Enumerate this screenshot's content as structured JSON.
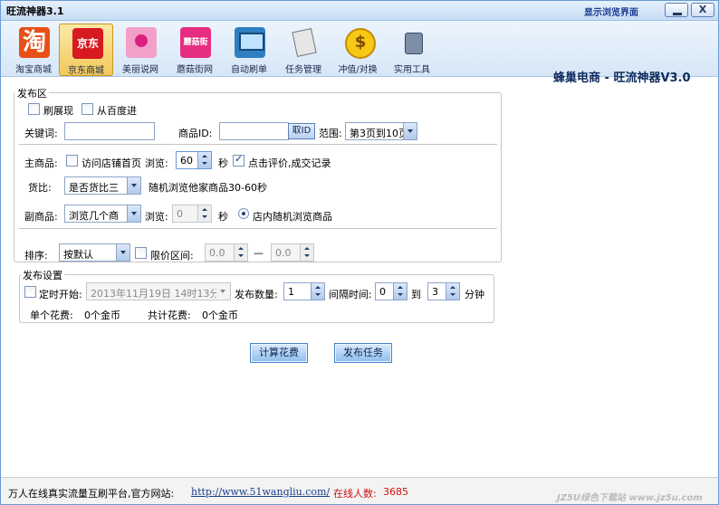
{
  "window": {
    "title": "旺流神器3.1",
    "mini_link": "显示浏览界面",
    "min_label": "",
    "close_label": "X"
  },
  "ribbon": {
    "items": [
      {
        "label": "淘宝商城",
        "icon": "taobao-icon",
        "glyph": "淘"
      },
      {
        "label": "京东商城",
        "icon": "jd-icon",
        "glyph": "京东"
      },
      {
        "label": "美丽说网",
        "icon": "meilishuo-icon",
        "glyph": ""
      },
      {
        "label": "蘑菇街网",
        "icon": "mogujie-icon",
        "glyph": "蘑菇街"
      },
      {
        "label": "自动刷单",
        "icon": "computer-icon",
        "glyph": ""
      },
      {
        "label": "任务管理",
        "icon": "task-icon",
        "glyph": ""
      },
      {
        "label": "冲值/对换",
        "icon": "coin-icon",
        "glyph": ""
      },
      {
        "label": "实用工具",
        "icon": "tool-icon",
        "glyph": ""
      }
    ],
    "active_index": 1,
    "brand": "蜂巢电商 - 旺流神器V3.0"
  },
  "publish": {
    "title": "发布区",
    "cb_shuazhan": "刷展现",
    "cb_baidu": "从百度进",
    "keyword_label": "关键词:",
    "keyword_value": "",
    "product_id_label": "商品ID:",
    "product_id_value": "",
    "fetch_id_btn": "取ID",
    "range_label": "范围:",
    "range_value": "第3页到10页",
    "main_label": "主商品:",
    "visit_home_label": "访问店铺首页",
    "browse_label": "浏览:",
    "browse_value": "60",
    "sec_label": "秒",
    "comment_label": "点击评价,成交记录",
    "compare_label": "货比:",
    "compare_value": "是否货比三",
    "compare_note": "随机浏览他家商品30-60秒",
    "sub_label": "副商品:",
    "sub_value": "浏览几个商",
    "sub_browse_label": "浏览:",
    "sub_browse_value": "0",
    "sub_sec_label": "秒",
    "sub_random_label": "店内随机浏览商品",
    "sort_label": "排序:",
    "sort_value": "按默认",
    "price_range_label": "限价区间:",
    "price_min": "0.0",
    "price_dash": "—",
    "price_max": "0.0"
  },
  "settings": {
    "title": "发布设置",
    "timer_label": "定时开始:",
    "timer_value": "2013年11月19日 14时13分",
    "count_label": "发布数量:",
    "count_value": "1",
    "interval_label": "间隔时间:",
    "interval_from": "0",
    "to_label": "到",
    "interval_to": "3",
    "minute_label": "分钟",
    "single_cost_label": "单个花费:",
    "single_cost_value": "0个金币",
    "total_cost_label": "共计花费:",
    "total_cost_value": "0个金币"
  },
  "actions": {
    "calc_btn": "计算花费",
    "publish_btn": "发布任务"
  },
  "status": {
    "slogan": "万人在线真实流量互刷平台,官方网站:",
    "url": "http://www.51wangliu.com/",
    "online_label": "在线人数:",
    "online_count": "3685"
  },
  "watermark": "JZ5U绿色下载站 www.jz5u.com",
  "colors": {
    "accent": "#6a9bd4",
    "active_tab": "#f3c85a",
    "online_count": "#d01010"
  }
}
